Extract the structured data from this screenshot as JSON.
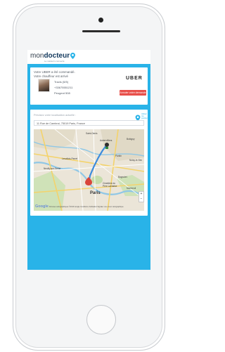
{
  "app": {
    "logo_prefix": "mon",
    "logo_brand": "docteur",
    "tagline": "Le médecin connecté",
    "brand_color": "#12385c",
    "accent_color": "#29b3e8"
  },
  "ride": {
    "line1": "Votre UBER a été commandé.",
    "line2": "Votre chauffeur est arrivé",
    "driver_name": "Travis (5/5)",
    "driver_phone": "+33675551211",
    "driver_car": "Peugeot 508",
    "service_logo": "UBER",
    "cancel_label": "Annuler votre demande",
    "cancel_color": "#e8504b"
  },
  "location": {
    "label": "Précisez votre localisation actuelle :",
    "use_location_label": "Utiliser ma position",
    "address_value": "11 Rue de Cambrai, 75019 Paris, France"
  },
  "map": {
    "labels": {
      "saint_denis": "Saint-Denis",
      "aubervilliers": "Aubervilliers",
      "bobigny": "Bobigny",
      "pantin": "Pantin",
      "noisy": "Noisy-le-Sec",
      "montreuil": "Montreuil",
      "bagnolet": "Bagnolet",
      "paris": "Paris",
      "neuilly": "Neuilly-sur-Seine",
      "levallois": "Levallois-Perret",
      "cimetiere": "Cimetière du Père Lachaise"
    },
    "google": "Google",
    "attribution": "Données cartographiques ©2016 Google   Conditions d'utilisation   Signaler une erreur cartographique",
    "zoom_in": "+",
    "zoom_out": "−"
  }
}
